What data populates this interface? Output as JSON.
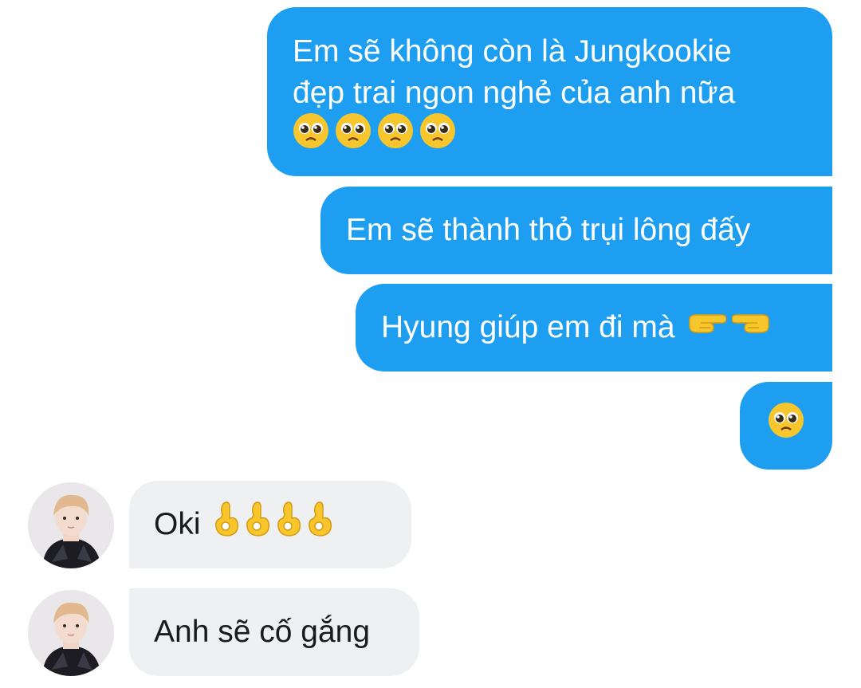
{
  "colors": {
    "sent_bubble": "#1e9ef0",
    "received_bubble": "#eef0f2",
    "background": "#ffffff",
    "emoji_yellow": "#f7c52c"
  },
  "messages": [
    {
      "side": "sent",
      "lines": [
        "Em sẽ không còn là Jungkookie",
        "đẹp trai ngon nghẻ của anh nữa"
      ],
      "emojis": [
        "pleading-face-emoji",
        "pleading-face-emoji",
        "pleading-face-emoji",
        "pleading-face-emoji"
      ]
    },
    {
      "side": "sent",
      "text": "Em sẽ thành thỏ trụi lông đấy"
    },
    {
      "side": "sent",
      "text": "Hyung giúp em đi mà",
      "emojis": [
        "pointing-right-emoji",
        "pointing-left-emoji"
      ]
    },
    {
      "side": "sent",
      "emojis": [
        "pleading-face-emoji"
      ]
    },
    {
      "side": "received",
      "text": "Oki",
      "emojis": [
        "ok-hand-emoji",
        "ok-hand-emoji",
        "ok-hand-emoji",
        "ok-hand-emoji"
      ]
    },
    {
      "side": "received",
      "text": "Anh sẽ cố gắng"
    }
  ]
}
